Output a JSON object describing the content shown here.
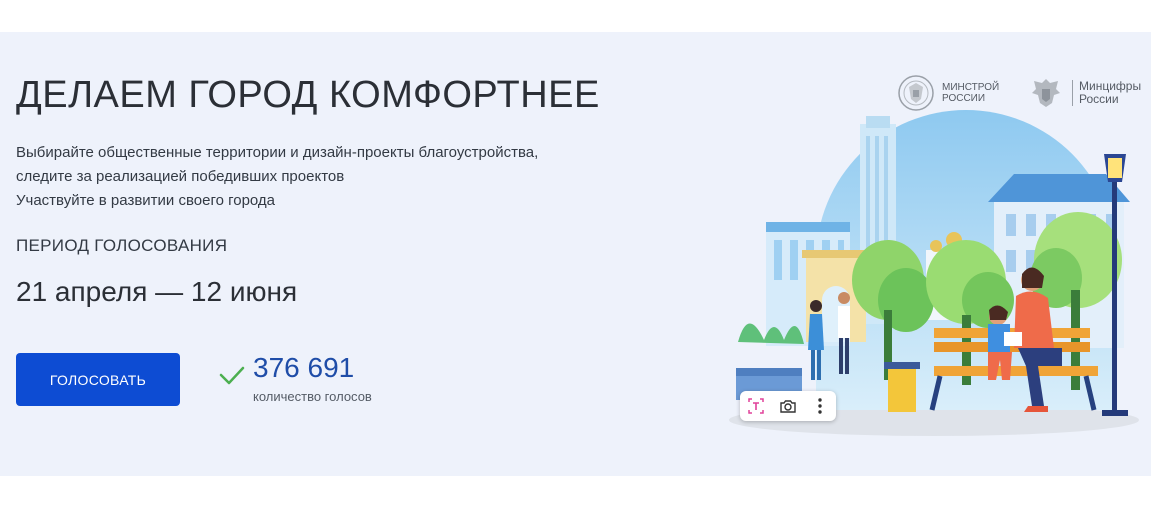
{
  "hero": {
    "title": "ДЕЛАЕМ ГОРОД КОМФОРТНЕЕ",
    "description_lines": [
      "Выбирайте общественные территории и дизайн-проекты благоустройства,",
      "следите за реализацией победивших проектов",
      "Участвуйте в развитии своего города"
    ],
    "period_label": "ПЕРИОД ГОЛОСОВАНИЯ",
    "period_dates": "21 апреля — 12 июня"
  },
  "vote": {
    "button_label": "ГОЛОСОВАТЬ",
    "count": "376 691",
    "count_label": "количество голосов"
  },
  "logos": {
    "minstroy": {
      "line1": "МИНСТРОЙ",
      "line2": "РОССИИ"
    },
    "mintsifry": {
      "line1": "Минцифры",
      "line2": "России"
    }
  },
  "colors": {
    "banner_bg": "#eef2fb",
    "button_bg": "#0d4cd3",
    "count_text": "#1f4da8",
    "check": "#4caf50"
  },
  "icons": {
    "check": "check-icon",
    "ocr": "text-select-icon",
    "camera": "camera-icon",
    "more": "more-vertical-icon"
  }
}
